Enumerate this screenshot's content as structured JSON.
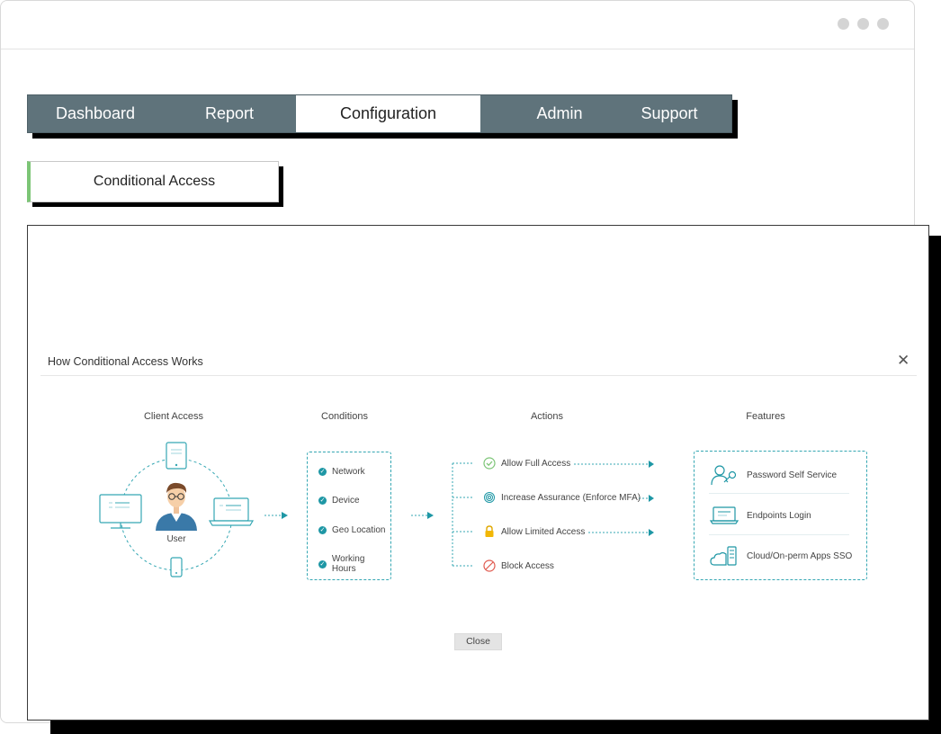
{
  "nav": {
    "items": [
      {
        "label": "Dashboard",
        "active": false
      },
      {
        "label": "Report",
        "active": false
      },
      {
        "label": "Configuration",
        "active": true
      },
      {
        "label": "Admin",
        "active": false
      },
      {
        "label": "Support",
        "active": false
      }
    ]
  },
  "section_button": {
    "label": "Conditional Access",
    "accent_color": "#7cc576"
  },
  "modal": {
    "title": "How Conditional Access Works",
    "close_label": "Close",
    "columns": {
      "client_access": {
        "heading": "Client Access",
        "user_label": "User"
      },
      "conditions": {
        "heading": "Conditions",
        "items": [
          "Network",
          "Device",
          "Geo Location",
          "Working Hours"
        ]
      },
      "actions": {
        "heading": "Actions",
        "items": [
          {
            "label": "Allow Full Access",
            "icon": "check-circle-icon"
          },
          {
            "label": "Increase Assurance (Enforce MFA)",
            "icon": "fingerprint-icon"
          },
          {
            "label": "Allow Limited Access",
            "icon": "lock-icon"
          },
          {
            "label": "Block Access",
            "icon": "block-icon"
          }
        ]
      },
      "features": {
        "heading": "Features",
        "items": [
          {
            "label": "Password Self Service",
            "icon": "user-key-icon"
          },
          {
            "label": "Endpoints Login",
            "icon": "laptop-icon"
          },
          {
            "label": "Cloud/On-perm Apps SSO",
            "icon": "cloud-server-icon"
          }
        ]
      }
    }
  },
  "colors": {
    "nav_bg": "#5f737b",
    "teal": "#1e97a5",
    "accent_green": "#7cc576"
  }
}
